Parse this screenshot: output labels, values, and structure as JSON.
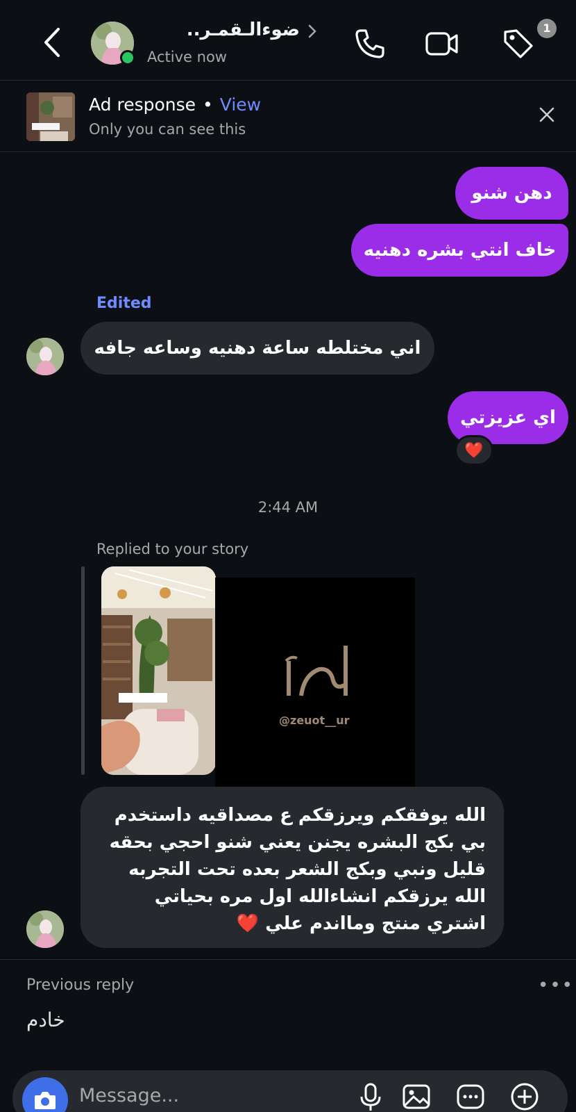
{
  "header": {
    "contact_name": "ضوءالـقمـر..",
    "status": "Active now",
    "badge_count": "1"
  },
  "ad": {
    "title": "Ad response",
    "separator": "•",
    "view_label": "View",
    "subtitle": "Only you can see this"
  },
  "messages": {
    "out1": "دهن شنو",
    "out2": "خاف انتي بشره دهنيه",
    "edited_label": "Edited",
    "in1": "اني مختلطه ساعة دهنيه وساعه جافه",
    "out3": "اي عزيزتي",
    "reaction": "❤️",
    "timestamp": "2:44 AM",
    "replied_label": "Replied to your story",
    "story_handle": "@zeuot__ur",
    "in2": "الله يوفقكم ويرزقكم ع مصداقيه داستخدم بي بكج البشره يجنن يعني شنو احجي بحقه قليل ونبي وبكج الشعر بعده تحت التجربه الله يرزقكم انشاءالله اول مره بحياتي اشتري منتج ومااندم علي ❤️"
  },
  "previous_reply": {
    "label": "Previous reply",
    "more": "•••",
    "text": "خادم"
  },
  "composer": {
    "placeholder": "Message..."
  },
  "colors": {
    "outgoing_bubble": "#9b2de8",
    "incoming_bubble": "#262a2f",
    "link_blue": "#6f8cff",
    "online_green": "#2ac55e"
  }
}
